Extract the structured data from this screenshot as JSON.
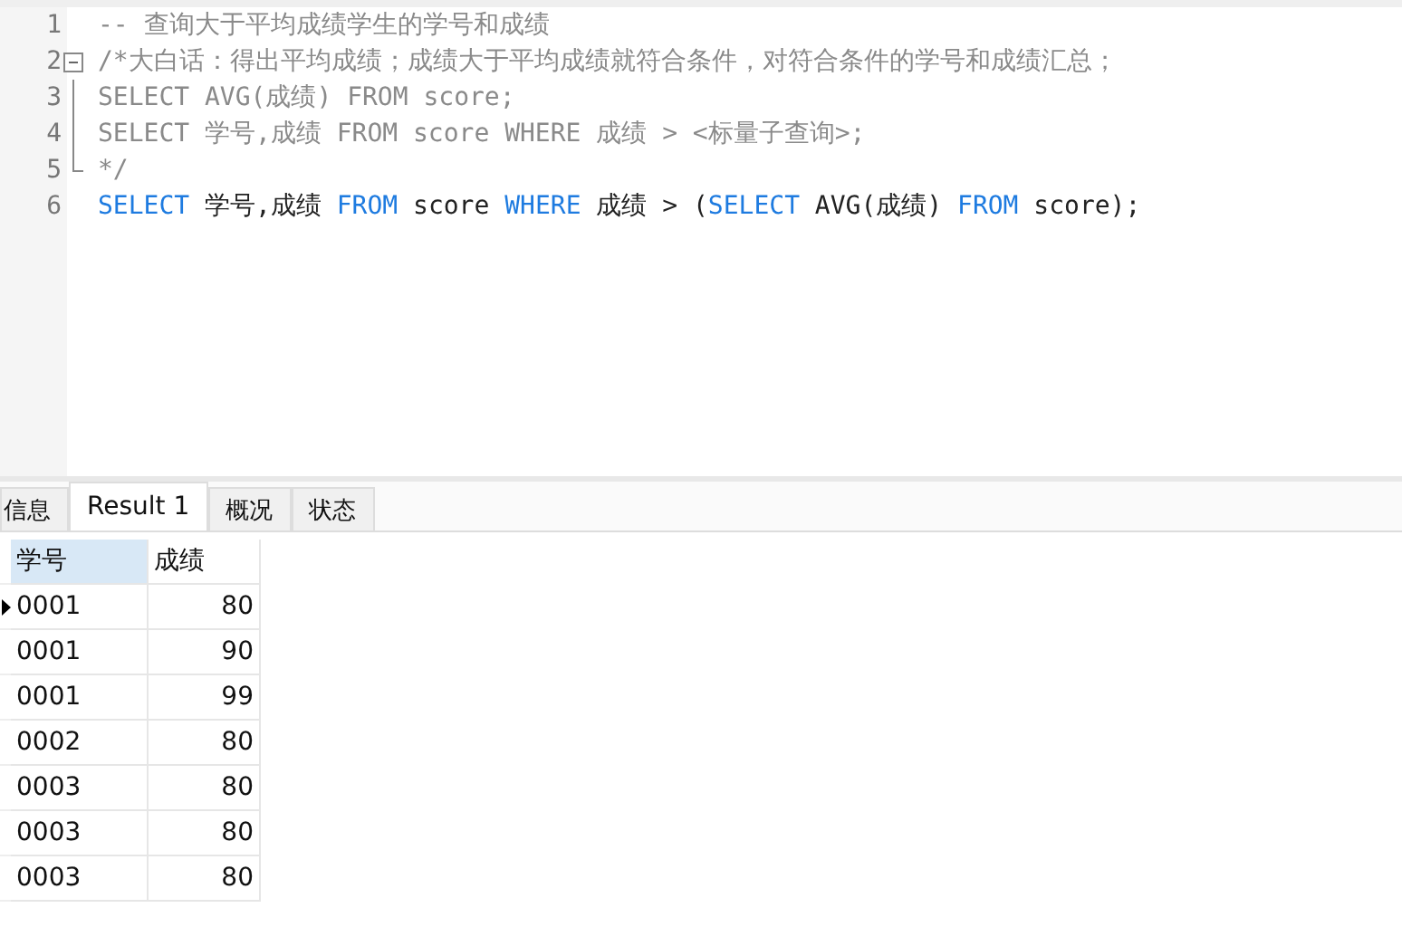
{
  "editor": {
    "lines": [
      {
        "number": "1",
        "tokens": [
          {
            "kind": "comment",
            "text": "-- 查询大于平均成绩学生的学号和成绩"
          }
        ]
      },
      {
        "number": "2",
        "fold_start": true,
        "tokens": [
          {
            "kind": "comment",
            "text": "/*大白话：得出平均成绩；成绩大于平均成绩就符合条件，对符合条件的学号和成绩汇总；"
          }
        ]
      },
      {
        "number": "3",
        "fold_guide": true,
        "tokens": [
          {
            "kind": "comment",
            "text": "SELECT AVG(成绩) FROM score;"
          }
        ]
      },
      {
        "number": "4",
        "fold_guide": true,
        "tokens": [
          {
            "kind": "comment",
            "text": "SELECT 学号,成绩 FROM score WHERE 成绩 > <标量子查询>;"
          }
        ]
      },
      {
        "number": "5",
        "fold_end": true,
        "tokens": [
          {
            "kind": "comment",
            "text": "*/"
          }
        ]
      },
      {
        "number": "6",
        "tokens": [
          {
            "kind": "keyword",
            "text": "SELECT"
          },
          {
            "kind": "plain",
            "text": " 学号,成绩 "
          },
          {
            "kind": "keyword",
            "text": "FROM"
          },
          {
            "kind": "plain",
            "text": " score "
          },
          {
            "kind": "keyword",
            "text": "WHERE"
          },
          {
            "kind": "plain",
            "text": " 成绩 > ("
          },
          {
            "kind": "keyword",
            "text": "SELECT"
          },
          {
            "kind": "plain",
            "text": " AVG(成绩) "
          },
          {
            "kind": "keyword",
            "text": "FROM"
          },
          {
            "kind": "plain",
            "text": " score);"
          }
        ]
      }
    ]
  },
  "tabs": [
    {
      "label": "信息",
      "selected": false
    },
    {
      "label": "Result 1",
      "selected": true
    },
    {
      "label": "概况",
      "selected": false
    },
    {
      "label": "状态",
      "selected": false
    }
  ],
  "table": {
    "columns": [
      "学号",
      "成绩"
    ],
    "rows": [
      {
        "cells": [
          "0001",
          "80"
        ],
        "current": true
      },
      {
        "cells": [
          "0001",
          "90"
        ],
        "current": false
      },
      {
        "cells": [
          "0001",
          "99"
        ],
        "current": false
      },
      {
        "cells": [
          "0002",
          "80"
        ],
        "current": false
      },
      {
        "cells": [
          "0003",
          "80"
        ],
        "current": false
      },
      {
        "cells": [
          "0003",
          "80"
        ],
        "current": false
      },
      {
        "cells": [
          "0003",
          "80"
        ],
        "current": false
      }
    ]
  }
}
